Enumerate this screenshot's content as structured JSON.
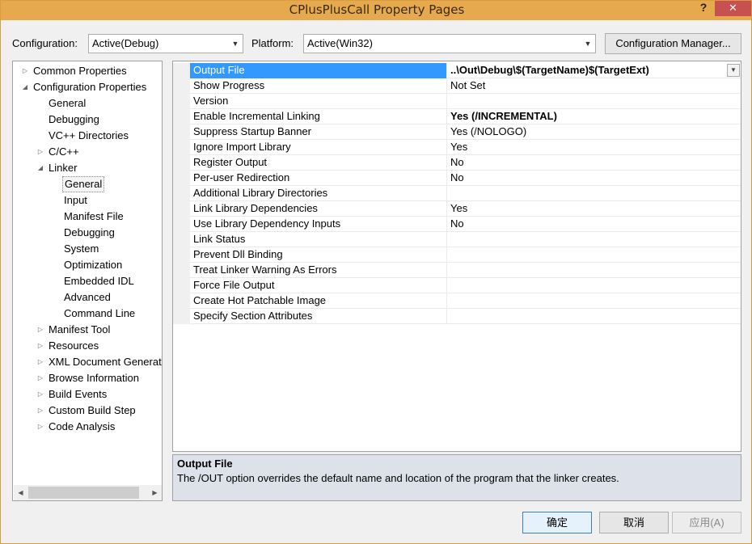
{
  "window": {
    "title": "CPlusPlusCall Property Pages",
    "help_label": "?",
    "close_label": "✕"
  },
  "toolbar": {
    "configuration_label": "Configuration:",
    "configuration_value": "Active(Debug)",
    "platform_label": "Platform:",
    "platform_value": "Active(Win32)",
    "config_manager_label": "Configuration Manager..."
  },
  "tree": {
    "items": [
      {
        "label": "Common Properties",
        "level": 0,
        "toggle": "collapsed"
      },
      {
        "label": "Configuration Properties",
        "level": 0,
        "toggle": "expanded"
      },
      {
        "label": "General",
        "level": 1,
        "toggle": "none"
      },
      {
        "label": "Debugging",
        "level": 1,
        "toggle": "none"
      },
      {
        "label": "VC++ Directories",
        "level": 1,
        "toggle": "none"
      },
      {
        "label": "C/C++",
        "level": 1,
        "toggle": "collapsed"
      },
      {
        "label": "Linker",
        "level": 1,
        "toggle": "expanded"
      },
      {
        "label": "General",
        "level": 2,
        "toggle": "none",
        "selected": true
      },
      {
        "label": "Input",
        "level": 2,
        "toggle": "none"
      },
      {
        "label": "Manifest File",
        "level": 2,
        "toggle": "none"
      },
      {
        "label": "Debugging",
        "level": 2,
        "toggle": "none"
      },
      {
        "label": "System",
        "level": 2,
        "toggle": "none"
      },
      {
        "label": "Optimization",
        "level": 2,
        "toggle": "none"
      },
      {
        "label": "Embedded IDL",
        "level": 2,
        "toggle": "none"
      },
      {
        "label": "Advanced",
        "level": 2,
        "toggle": "none"
      },
      {
        "label": "Command Line",
        "level": 2,
        "toggle": "none"
      },
      {
        "label": "Manifest Tool",
        "level": 1,
        "toggle": "collapsed"
      },
      {
        "label": "Resources",
        "level": 1,
        "toggle": "collapsed"
      },
      {
        "label": "XML Document Generat",
        "level": 1,
        "toggle": "collapsed"
      },
      {
        "label": "Browse Information",
        "level": 1,
        "toggle": "collapsed"
      },
      {
        "label": "Build Events",
        "level": 1,
        "toggle": "collapsed"
      },
      {
        "label": "Custom Build Step",
        "level": 1,
        "toggle": "collapsed"
      },
      {
        "label": "Code Analysis",
        "level": 1,
        "toggle": "collapsed"
      }
    ]
  },
  "grid": {
    "rows": [
      {
        "name": "Output File",
        "value": "..\\Out\\Debug\\$(TargetName)$(TargetExt)",
        "bold": true,
        "selected": true
      },
      {
        "name": "Show Progress",
        "value": "Not Set",
        "bold": false
      },
      {
        "name": "Version",
        "value": "",
        "bold": false
      },
      {
        "name": "Enable Incremental Linking",
        "value": "Yes (/INCREMENTAL)",
        "bold": true
      },
      {
        "name": "Suppress Startup Banner",
        "value": "Yes (/NOLOGO)",
        "bold": false
      },
      {
        "name": "Ignore Import Library",
        "value": "Yes",
        "bold": false
      },
      {
        "name": "Register Output",
        "value": "No",
        "bold": false
      },
      {
        "name": "Per-user Redirection",
        "value": "No",
        "bold": false
      },
      {
        "name": "Additional Library Directories",
        "value": "",
        "bold": false
      },
      {
        "name": "Link Library Dependencies",
        "value": "Yes",
        "bold": false
      },
      {
        "name": "Use Library Dependency Inputs",
        "value": "No",
        "bold": false
      },
      {
        "name": "Link Status",
        "value": "",
        "bold": false
      },
      {
        "name": "Prevent Dll Binding",
        "value": "",
        "bold": false
      },
      {
        "name": "Treat Linker Warning As Errors",
        "value": "",
        "bold": false
      },
      {
        "name": "Force File Output",
        "value": "",
        "bold": false
      },
      {
        "name": "Create Hot Patchable Image",
        "value": "",
        "bold": false
      },
      {
        "name": "Specify Section Attributes",
        "value": "",
        "bold": false
      }
    ]
  },
  "description": {
    "title": "Output File",
    "text": "The /OUT option overrides the default name and location of the program that the linker creates."
  },
  "buttons": {
    "ok": "确定",
    "cancel": "取消",
    "apply": "应用(A)"
  },
  "icons": {
    "collapsed": "triangle-right-icon",
    "expanded": "triangle-down-icon"
  }
}
